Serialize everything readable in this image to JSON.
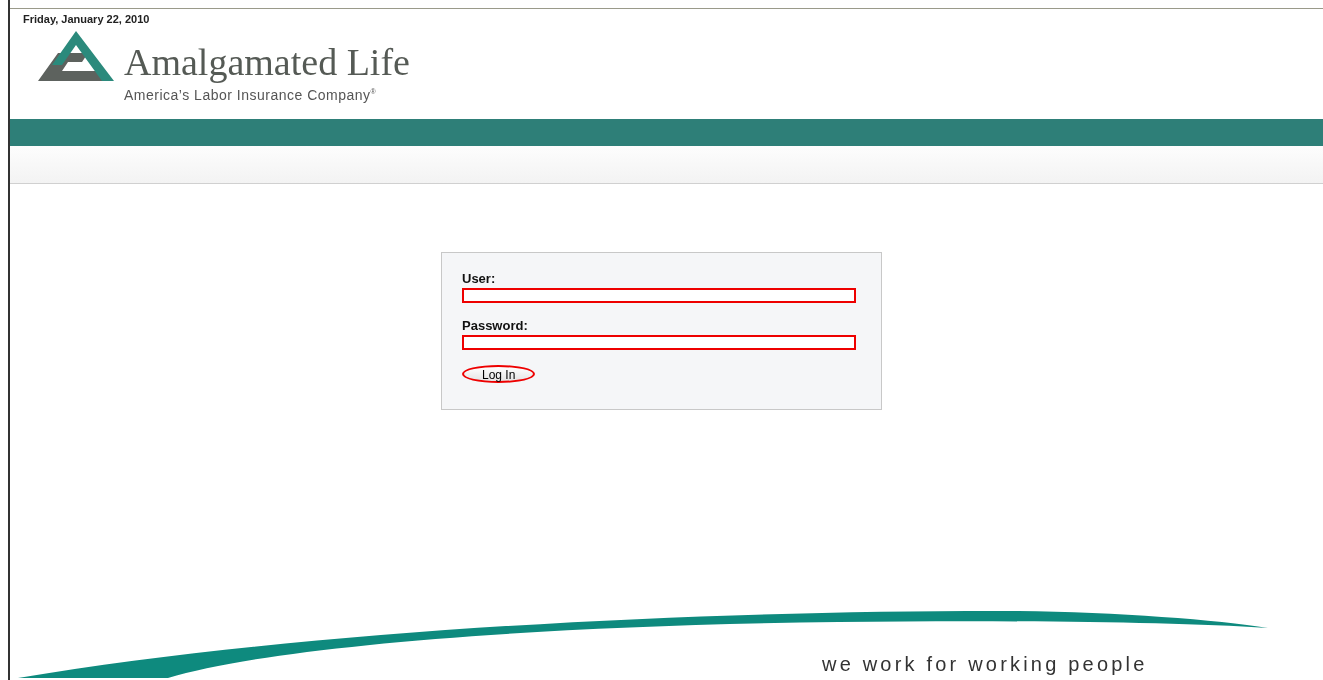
{
  "header": {
    "date": "Friday, January 22, 2010",
    "logo_name": "Amalgamated Life",
    "logo_tagline": "America’s Labor Insurance Company$^{®}$"
  },
  "login": {
    "fields": [
      {
        "label": "User:",
        "highlighted": true
      },
      {
        "label": "Password:",
        "highlighted": true
      }
    ],
    "button": {
      "label": "Log In",
      "highlighted": true
    }
  },
  "footer": {
    "slogan": "we work for working people"
  }
}
